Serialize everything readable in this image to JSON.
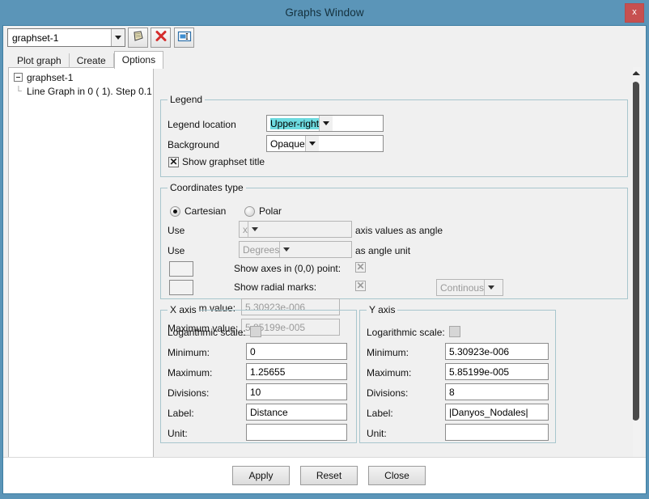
{
  "window": {
    "title": "Graphs Window",
    "close_label": "x"
  },
  "toolbar": {
    "graphset_combo_value": "graphset-1",
    "buttons": [
      {
        "name": "new-graphset-button",
        "icon": "page-icon"
      },
      {
        "name": "delete-graphset-button",
        "icon": "red-x-icon"
      },
      {
        "name": "rename-graphset-button",
        "icon": "window-rename-icon"
      }
    ]
  },
  "tabs": [
    {
      "label": "Plot graph",
      "active": false
    },
    {
      "label": "Create",
      "active": false
    },
    {
      "label": "Options",
      "active": true
    }
  ],
  "tree": {
    "root_label": "graphset-1",
    "child_label": "Line Graph in 0 ( 1). Step 0.1"
  },
  "legend_group": {
    "caption": "Legend",
    "location_label": "Legend location",
    "location_value": "Upper-right",
    "background_label": "Background",
    "background_value": "Opaque",
    "show_title_label": "Show graphset title",
    "show_title_checked": true,
    "highlight_color": "#6ddbe0"
  },
  "coordinates_group": {
    "caption": "Coordinates type",
    "cartesian_label": "Cartesian",
    "polar_label": "Polar",
    "cartesian_selected": true,
    "polar_selected": false,
    "use_label_1": "Use",
    "angle_axis_value": "x",
    "angle_axis_suffix": "axis values as angle",
    "use_label_2": "Use",
    "angle_unit_value": "Degrees",
    "angle_unit_suffix": "as angle unit",
    "show_axes_label": "Show axes in (0,0) point:",
    "show_axes_checked": true,
    "show_radial_label": "Show radial marks:",
    "show_radial_checked": true,
    "radial_mode_value": "Continous",
    "min_label": "Minimum value:",
    "min_value": "5.30923e-006",
    "max_label": "Maximum value:",
    "max_value": "5.85199e-005"
  },
  "x_axis": {
    "caption": "X axis",
    "log_label": "Logarithmic scale:",
    "log_checked": false,
    "minimum_label": "Minimum:",
    "minimum_value": "0",
    "maximum_label": "Maximum:",
    "maximum_value": "1.25655",
    "divisions_label": "Divisions:",
    "divisions_value": "10",
    "label_label": "Label:",
    "label_value": "Distance",
    "unit_label": "Unit:",
    "unit_value": ""
  },
  "y_axis": {
    "caption": "Y axis",
    "log_label": "Logarithmic scale:",
    "log_checked": false,
    "minimum_label": "Minimum:",
    "minimum_value": "5.30923e-006",
    "maximum_label": "Maximum:",
    "maximum_value": "5.85199e-005",
    "divisions_label": "Divisions:",
    "divisions_value": "8",
    "label_label": "Label:",
    "label_value": "|Danyos_Nodales|",
    "unit_label": "Unit:",
    "unit_value": ""
  },
  "footer": {
    "apply_label": "Apply",
    "reset_label": "Reset",
    "close_label": "Close"
  }
}
